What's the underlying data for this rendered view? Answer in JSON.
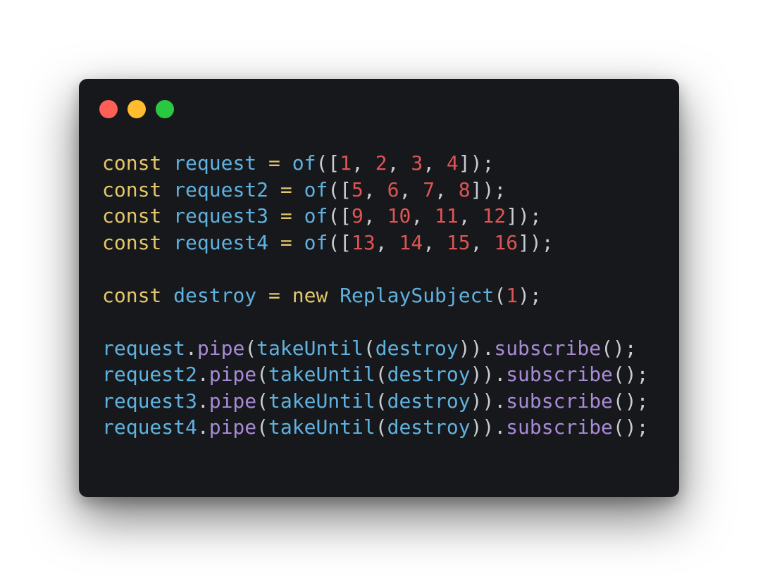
{
  "window": {
    "controls": [
      "close",
      "minimize",
      "maximize"
    ],
    "colors": {
      "background": "#17181b",
      "close": "#ff5f57",
      "minimize": "#febc2e",
      "maximize": "#28c840"
    }
  },
  "code": {
    "language": "javascript",
    "lines": [
      [
        {
          "t": "kw",
          "v": "const"
        },
        {
          "t": "p",
          "v": " "
        },
        {
          "t": "id",
          "v": "request"
        },
        {
          "t": "p",
          "v": " "
        },
        {
          "t": "kw",
          "v": "="
        },
        {
          "t": "p",
          "v": " "
        },
        {
          "t": "id",
          "v": "of"
        },
        {
          "t": "p",
          "v": "(["
        },
        {
          "t": "num",
          "v": "1"
        },
        {
          "t": "p",
          "v": ", "
        },
        {
          "t": "num",
          "v": "2"
        },
        {
          "t": "p",
          "v": ", "
        },
        {
          "t": "num",
          "v": "3"
        },
        {
          "t": "p",
          "v": ", "
        },
        {
          "t": "num",
          "v": "4"
        },
        {
          "t": "p",
          "v": "]);"
        }
      ],
      [
        {
          "t": "kw",
          "v": "const"
        },
        {
          "t": "p",
          "v": " "
        },
        {
          "t": "id",
          "v": "request2"
        },
        {
          "t": "p",
          "v": " "
        },
        {
          "t": "kw",
          "v": "="
        },
        {
          "t": "p",
          "v": " "
        },
        {
          "t": "id",
          "v": "of"
        },
        {
          "t": "p",
          "v": "(["
        },
        {
          "t": "num",
          "v": "5"
        },
        {
          "t": "p",
          "v": ", "
        },
        {
          "t": "num",
          "v": "6"
        },
        {
          "t": "p",
          "v": ", "
        },
        {
          "t": "num",
          "v": "7"
        },
        {
          "t": "p",
          "v": ", "
        },
        {
          "t": "num",
          "v": "8"
        },
        {
          "t": "p",
          "v": "]);"
        }
      ],
      [
        {
          "t": "kw",
          "v": "const"
        },
        {
          "t": "p",
          "v": " "
        },
        {
          "t": "id",
          "v": "request3"
        },
        {
          "t": "p",
          "v": " "
        },
        {
          "t": "kw",
          "v": "="
        },
        {
          "t": "p",
          "v": " "
        },
        {
          "t": "id",
          "v": "of"
        },
        {
          "t": "p",
          "v": "(["
        },
        {
          "t": "num",
          "v": "9"
        },
        {
          "t": "p",
          "v": ", "
        },
        {
          "t": "num",
          "v": "10"
        },
        {
          "t": "p",
          "v": ", "
        },
        {
          "t": "num",
          "v": "11"
        },
        {
          "t": "p",
          "v": ", "
        },
        {
          "t": "num",
          "v": "12"
        },
        {
          "t": "p",
          "v": "]);"
        }
      ],
      [
        {
          "t": "kw",
          "v": "const"
        },
        {
          "t": "p",
          "v": " "
        },
        {
          "t": "id",
          "v": "request4"
        },
        {
          "t": "p",
          "v": " "
        },
        {
          "t": "kw",
          "v": "="
        },
        {
          "t": "p",
          "v": " "
        },
        {
          "t": "id",
          "v": "of"
        },
        {
          "t": "p",
          "v": "(["
        },
        {
          "t": "num",
          "v": "13"
        },
        {
          "t": "p",
          "v": ", "
        },
        {
          "t": "num",
          "v": "14"
        },
        {
          "t": "p",
          "v": ", "
        },
        {
          "t": "num",
          "v": "15"
        },
        {
          "t": "p",
          "v": ", "
        },
        {
          "t": "num",
          "v": "16"
        },
        {
          "t": "p",
          "v": "]);"
        }
      ],
      [],
      [
        {
          "t": "kw",
          "v": "const"
        },
        {
          "t": "p",
          "v": " "
        },
        {
          "t": "id",
          "v": "destroy"
        },
        {
          "t": "p",
          "v": " "
        },
        {
          "t": "kw",
          "v": "="
        },
        {
          "t": "p",
          "v": " "
        },
        {
          "t": "kw",
          "v": "new"
        },
        {
          "t": "p",
          "v": " "
        },
        {
          "t": "id",
          "v": "ReplaySubject"
        },
        {
          "t": "p",
          "v": "("
        },
        {
          "t": "num",
          "v": "1"
        },
        {
          "t": "p",
          "v": ");"
        }
      ],
      [],
      [
        {
          "t": "id",
          "v": "request"
        },
        {
          "t": "p",
          "v": "."
        },
        {
          "t": "fn",
          "v": "pipe"
        },
        {
          "t": "p",
          "v": "("
        },
        {
          "t": "id",
          "v": "takeUntil"
        },
        {
          "t": "p",
          "v": "("
        },
        {
          "t": "id",
          "v": "destroy"
        },
        {
          "t": "p",
          "v": "))."
        },
        {
          "t": "fn",
          "v": "subscribe"
        },
        {
          "t": "p",
          "v": "();"
        }
      ],
      [
        {
          "t": "id",
          "v": "request2"
        },
        {
          "t": "p",
          "v": "."
        },
        {
          "t": "fn",
          "v": "pipe"
        },
        {
          "t": "p",
          "v": "("
        },
        {
          "t": "id",
          "v": "takeUntil"
        },
        {
          "t": "p",
          "v": "("
        },
        {
          "t": "id",
          "v": "destroy"
        },
        {
          "t": "p",
          "v": "))."
        },
        {
          "t": "fn",
          "v": "subscribe"
        },
        {
          "t": "p",
          "v": "();"
        }
      ],
      [
        {
          "t": "id",
          "v": "request3"
        },
        {
          "t": "p",
          "v": "."
        },
        {
          "t": "fn",
          "v": "pipe"
        },
        {
          "t": "p",
          "v": "("
        },
        {
          "t": "id",
          "v": "takeUntil"
        },
        {
          "t": "p",
          "v": "("
        },
        {
          "t": "id",
          "v": "destroy"
        },
        {
          "t": "p",
          "v": "))."
        },
        {
          "t": "fn",
          "v": "subscribe"
        },
        {
          "t": "p",
          "v": "();"
        }
      ],
      [
        {
          "t": "id",
          "v": "request4"
        },
        {
          "t": "p",
          "v": "."
        },
        {
          "t": "fn",
          "v": "pipe"
        },
        {
          "t": "p",
          "v": "("
        },
        {
          "t": "id",
          "v": "takeUntil"
        },
        {
          "t": "p",
          "v": "("
        },
        {
          "t": "id",
          "v": "destroy"
        },
        {
          "t": "p",
          "v": "))."
        },
        {
          "t": "fn",
          "v": "subscribe"
        },
        {
          "t": "p",
          "v": "();"
        }
      ]
    ],
    "token_colors": {
      "kw": "#e5c76b",
      "id": "#5fb2e0",
      "fn": "#a78bd6",
      "num": "#de5454",
      "p": "#c9ccd1"
    }
  }
}
